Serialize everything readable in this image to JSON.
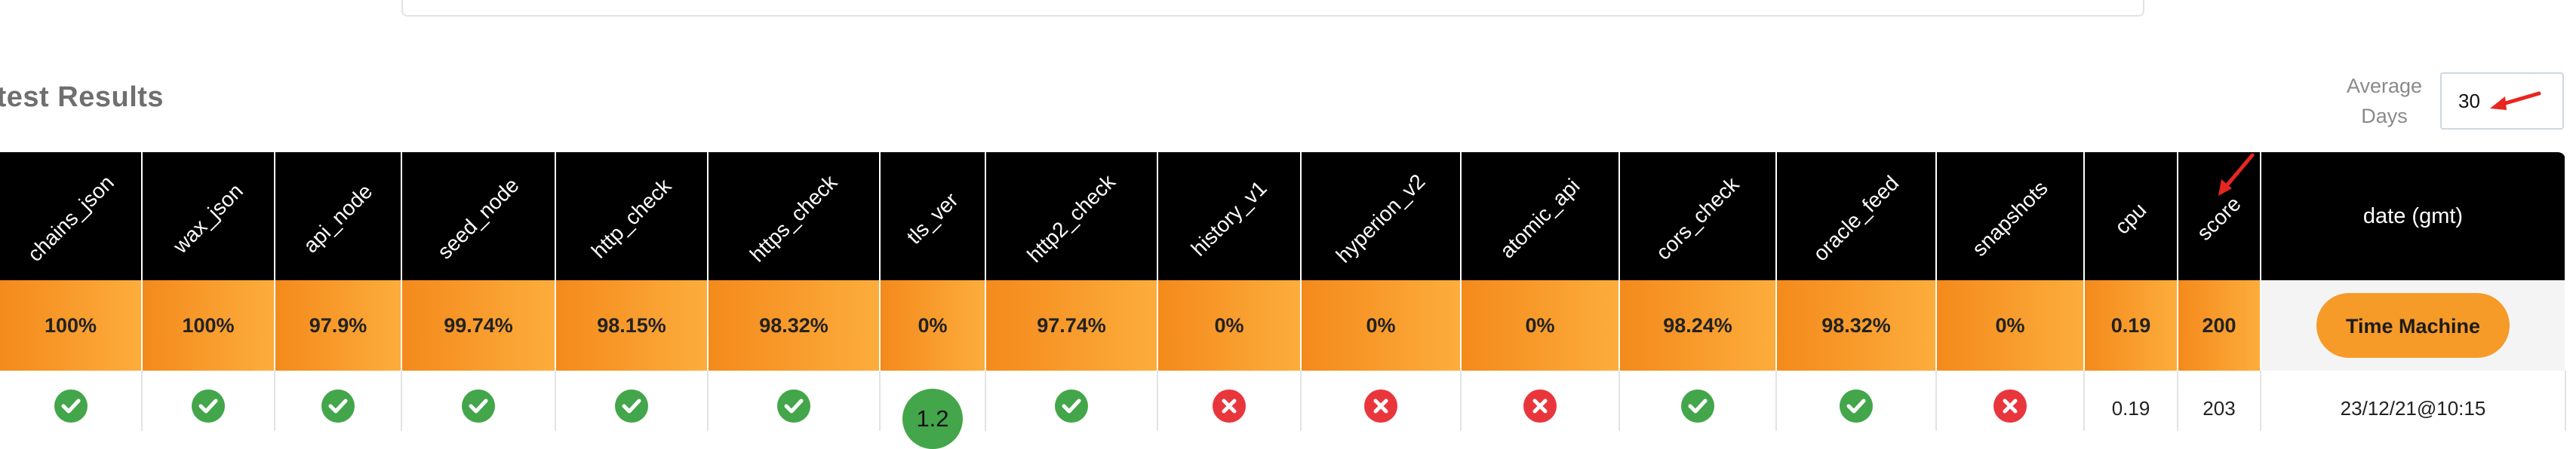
{
  "section_title": "atest Results",
  "average_days": {
    "label_line1": "Average",
    "label_line2": "Days",
    "value": "30"
  },
  "columns": [
    {
      "key": "chains_json",
      "label": "chains_json"
    },
    {
      "key": "wax_json",
      "label": "wax_json"
    },
    {
      "key": "api_node",
      "label": "api_node"
    },
    {
      "key": "seed_node",
      "label": "seed_node"
    },
    {
      "key": "http_check",
      "label": "http_check"
    },
    {
      "key": "https_check",
      "label": "https_check"
    },
    {
      "key": "tls_ver",
      "label": "tls_ver"
    },
    {
      "key": "http2_check",
      "label": "http2_check"
    },
    {
      "key": "history_v1",
      "label": "history_v1"
    },
    {
      "key": "hyperion_v2",
      "label": "hyperion_v2"
    },
    {
      "key": "atomic_api",
      "label": "atomic_api"
    },
    {
      "key": "cors_check",
      "label": "cors_check"
    },
    {
      "key": "oracle_feed",
      "label": "oracle_feed"
    },
    {
      "key": "snapshots",
      "label": "snapshots"
    },
    {
      "key": "cpu",
      "label": "cpu"
    },
    {
      "key": "score",
      "label": "score"
    },
    {
      "key": "date",
      "label": "date (gmt)"
    }
  ],
  "averages": [
    "100%",
    "100%",
    "97.9%",
    "99.74%",
    "98.15%",
    "98.32%",
    "0%",
    "97.74%",
    "0%",
    "0%",
    "0%",
    "98.24%",
    "98.32%",
    "0%",
    "0.19",
    "200"
  ],
  "time_machine_label": "Time Machine",
  "latest_row": {
    "chains_json": "pass",
    "wax_json": "pass",
    "api_node": "pass",
    "seed_node": "pass",
    "http_check": "pass",
    "https_check": "pass",
    "tls_ver": "1.2",
    "http2_check": "pass",
    "history_v1": "fail",
    "hyperion_v2": "fail",
    "atomic_api": "fail",
    "cors_check": "pass",
    "oracle_feed": "pass",
    "snapshots": "fail",
    "cpu": "0.19",
    "score": "203",
    "date": "23/12/21@10:15"
  },
  "colors": {
    "header_bg": "#000000",
    "avg_row_start": "#f48a1c",
    "avg_row_end": "#fcad3c",
    "pass_green": "#43a64a",
    "fail_red": "#e9363c",
    "annotation_arrow": "#e8261f"
  },
  "icons": {
    "pass": "check-circle-icon",
    "fail": "x-circle-icon"
  }
}
